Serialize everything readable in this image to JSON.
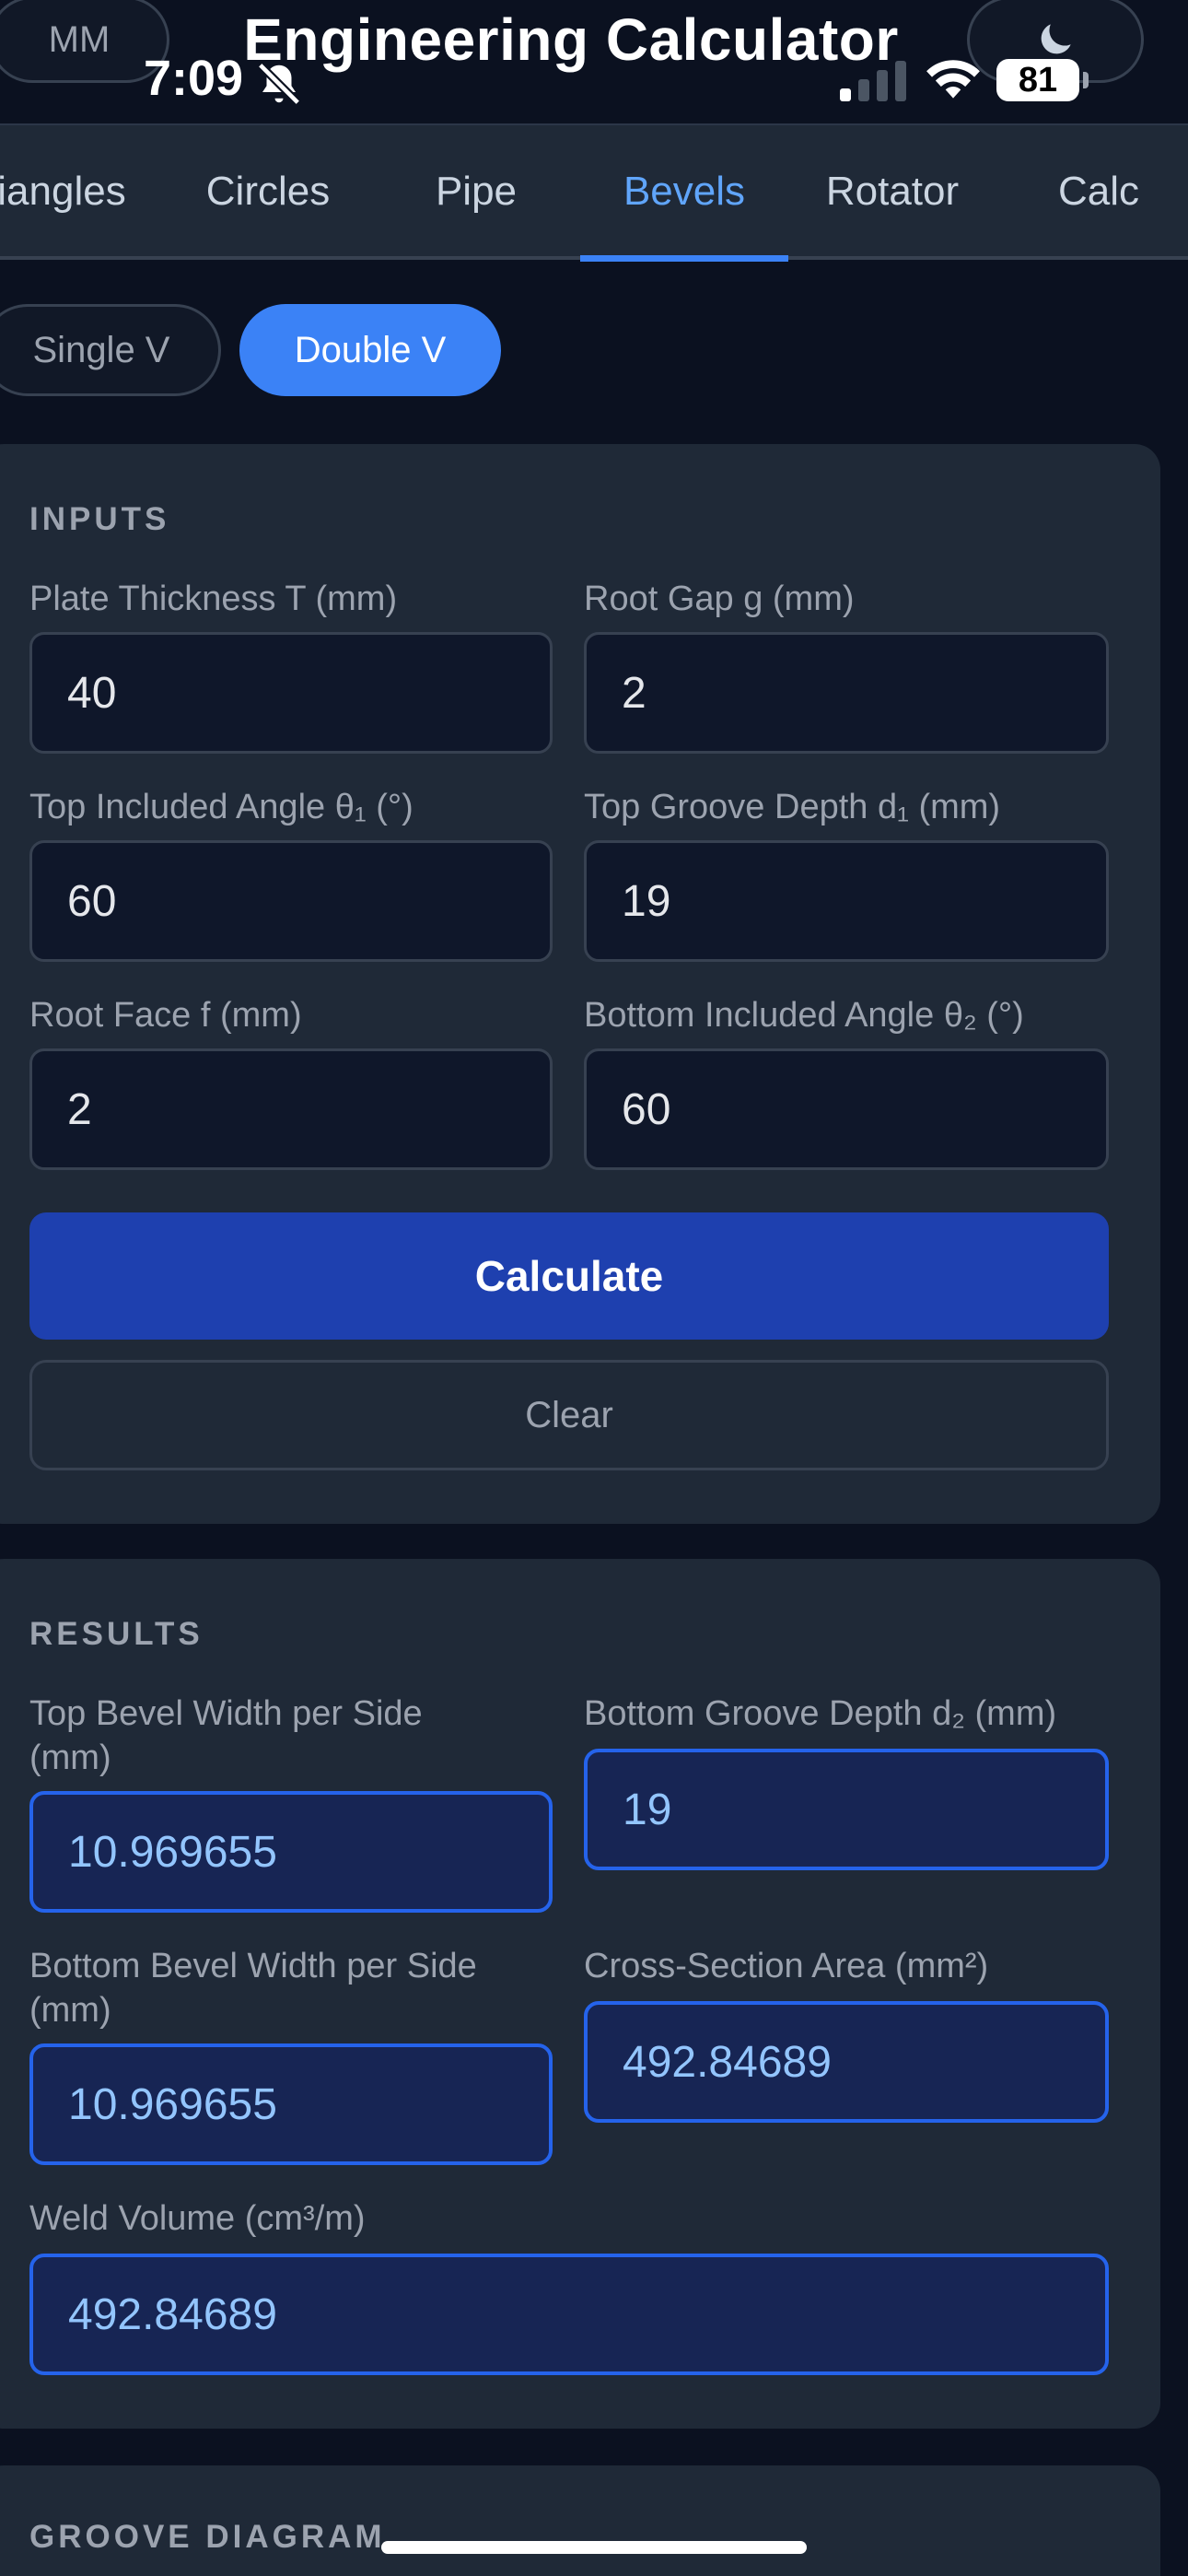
{
  "header": {
    "units_toggle": "MM",
    "title": "Engineering Calculator",
    "theme_icon": "moon-icon"
  },
  "status_bar": {
    "time": "7:09",
    "battery": "81"
  },
  "tabs": [
    {
      "label": "Triangles",
      "visible_text": "iangles"
    },
    {
      "label": "Circles",
      "visible_text": "Circles"
    },
    {
      "label": "Pipe",
      "visible_text": "Pipe"
    },
    {
      "label": "Bevels",
      "visible_text": "Bevels",
      "active": true
    },
    {
      "label": "Rotator",
      "visible_text": "Rotator"
    },
    {
      "label": "Calc",
      "visible_text": "Calc"
    }
  ],
  "bevel_type": {
    "options": [
      "Single V",
      "Double V"
    ],
    "selected": "Double V"
  },
  "inputs": {
    "title": "INPUTS",
    "plate_thickness": {
      "label": "Plate Thickness T (mm)",
      "value": "40"
    },
    "root_gap": {
      "label": "Root Gap g (mm)",
      "value": "2"
    },
    "top_angle": {
      "label": "Top Included Angle θ₁ (°)",
      "value": "60"
    },
    "top_depth": {
      "label": "Top Groove Depth d₁ (mm)",
      "value": "19"
    },
    "root_face": {
      "label": "Root Face f (mm)",
      "value": "2"
    },
    "bottom_angle": {
      "label": "Bottom Included Angle θ₂ (°)",
      "value": "60"
    },
    "calculate_label": "Calculate",
    "clear_label": "Clear"
  },
  "results": {
    "title": "RESULTS",
    "top_bevel_width": {
      "label_line1": "Top Bevel Width per Side",
      "label_line2": "(mm)",
      "value": "10.969655"
    },
    "bottom_depth": {
      "label": "Bottom Groove Depth d₂ (mm)",
      "value": "19"
    },
    "bottom_bevel_width": {
      "label_line1": "Bottom Bevel Width per Side",
      "label_line2": "(mm)",
      "value": "10.969655"
    },
    "cross_section_area": {
      "label": "Cross-Section Area (mm²)",
      "value": "492.84689"
    },
    "weld_volume": {
      "label": "Weld Volume (cm³/m)",
      "value": "492.84689"
    }
  },
  "diagram": {
    "title": "GROOVE DIAGRAM"
  },
  "colors": {
    "background": "#0b1120",
    "card": "#1f2937",
    "accent": "#3b82f6",
    "primary_button": "#1e40af",
    "result_field": "#172554"
  }
}
